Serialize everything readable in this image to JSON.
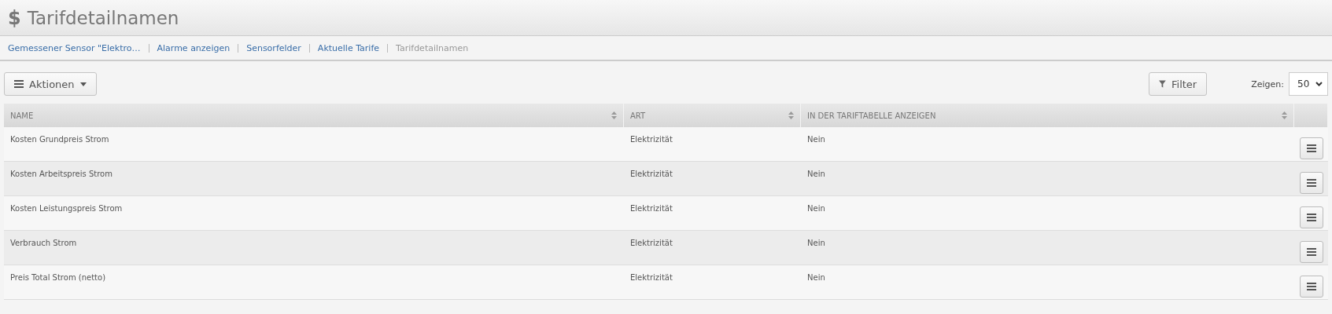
{
  "title_icon": "$",
  "page_title": "Tarifdetailnamen",
  "breadcrumbs": [
    {
      "label": "Gemessener Sensor \"Elektro…",
      "current": false
    },
    {
      "label": "Alarme anzeigen",
      "current": false
    },
    {
      "label": "Sensorfelder",
      "current": false
    },
    {
      "label": "Aktuelle Tarife",
      "current": false
    },
    {
      "label": "Tarifdetailnamen",
      "current": true
    }
  ],
  "actions_button": "Aktionen",
  "filter_button": "Filter",
  "show_label": "Zeigen:",
  "show_value": "50",
  "table": {
    "columns": [
      "NAME",
      "ART",
      "IN DER TARIFTABELLE ANZEIGEN"
    ],
    "rows": [
      {
        "cells": [
          "Kosten Grundpreis Strom",
          "Elektrizität",
          "Nein"
        ]
      },
      {
        "cells": [
          "Kosten Arbeitspreis Strom",
          "Elektrizität",
          "Nein"
        ]
      },
      {
        "cells": [
          "Kosten Leistungspreis Strom",
          "Elektrizität",
          "Nein"
        ]
      },
      {
        "cells": [
          "Verbrauch Strom",
          "Elektrizität",
          "Nein"
        ]
      },
      {
        "cells": [
          "Preis Total Strom (netto)",
          "Elektrizität",
          "Nein"
        ]
      }
    ]
  }
}
